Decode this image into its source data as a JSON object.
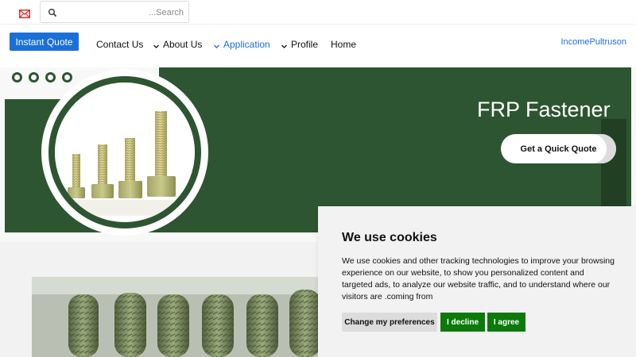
{
  "topbar": {
    "mail_icon": "envelope-icon",
    "search": {
      "placeholder": "...Search",
      "value": "",
      "icon": "search-icon"
    }
  },
  "nav": {
    "instant_quote": "Instant Quote",
    "items": [
      {
        "label": "Contact Us",
        "has_dropdown": false,
        "active": false
      },
      {
        "label": "About Us",
        "has_dropdown": true,
        "active": false
      },
      {
        "label": "Application",
        "has_dropdown": true,
        "active": true
      },
      {
        "label": "Profile",
        "has_dropdown": true,
        "active": false
      },
      {
        "label": "Home",
        "has_dropdown": false,
        "active": false
      }
    ],
    "brand": "IncomePultruson"
  },
  "hero": {
    "title": "FRP Fastener",
    "cta": "Get a Quick Quote",
    "top_dots": 4,
    "bottom_dots": 4
  },
  "cookie": {
    "title": "We use cookies",
    "text": "We use cookies and other tracking technologies to improve your browsing experience on our website, to show you personalized content and targeted ads, to analyze our website traffic, and to understand where our visitors are .coming from",
    "prefs_label": "Change my preferences",
    "decline_label": "I decline",
    "agree_label": "I agree"
  },
  "colors": {
    "brand_green": "#2e5531",
    "accent_blue": "#1a6fd8",
    "cookie_green": "#0b7a0b"
  }
}
